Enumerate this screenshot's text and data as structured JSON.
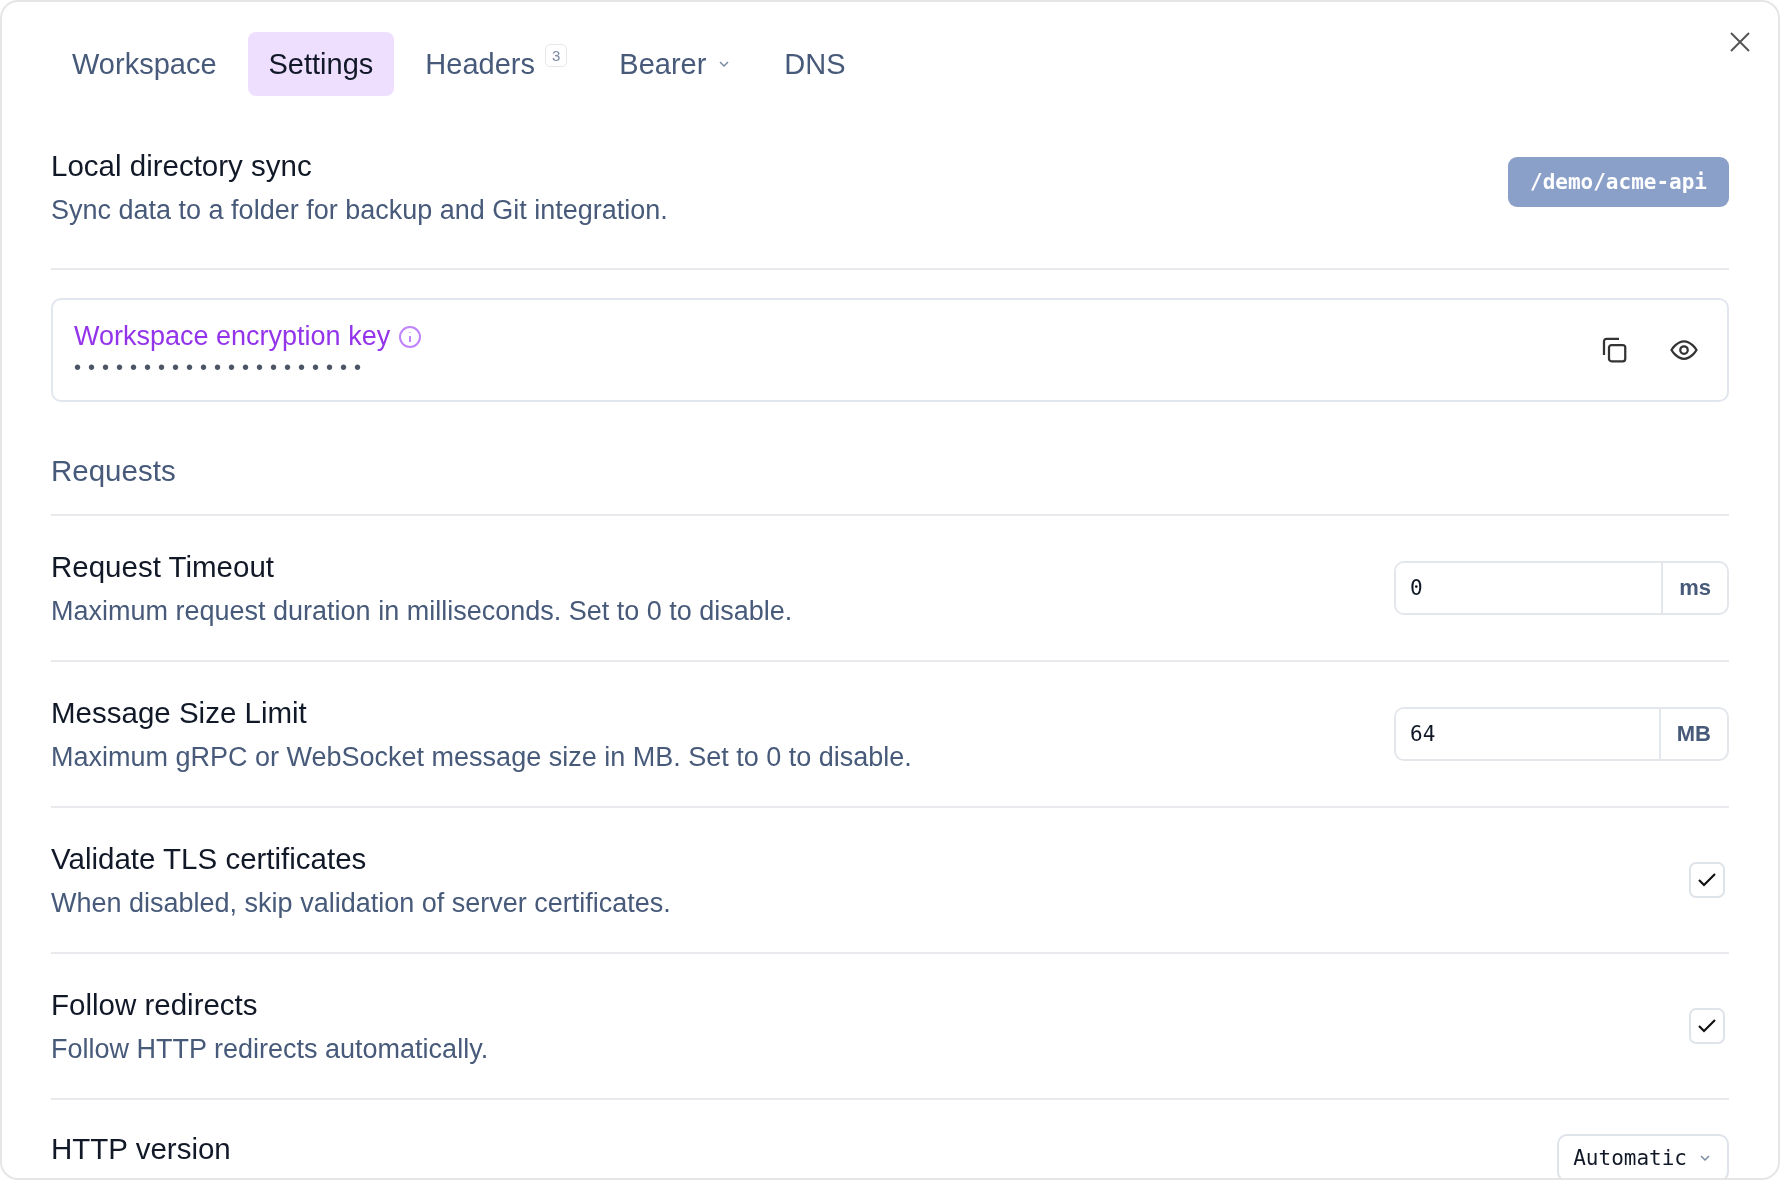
{
  "tabs": [
    {
      "label": "Workspace",
      "selected": false
    },
    {
      "label": "Settings",
      "selected": true
    },
    {
      "label": "Headers",
      "selected": false,
      "badge": "3"
    },
    {
      "label": "Bearer",
      "selected": false,
      "dropdown": true
    },
    {
      "label": "DNS",
      "selected": false
    }
  ],
  "sync": {
    "title": "Local directory sync",
    "description": "Sync data to a folder for backup and Git integration.",
    "path": "/demo/acme-api"
  },
  "encryption_key": {
    "label": "Workspace encryption key",
    "value": "•••••••••••••••••••••"
  },
  "section_title": "Requests",
  "settings": [
    {
      "kind": "number",
      "title": "Request Timeout",
      "description": "Maximum request duration in milliseconds. Set to 0 to disable.",
      "value": "0",
      "unit": "ms"
    },
    {
      "kind": "number",
      "title": "Message Size Limit",
      "description": "Maximum gRPC or WebSocket message size in MB. Set to 0 to disable.",
      "value": "64",
      "unit": "MB"
    },
    {
      "kind": "checkbox",
      "title": "Validate TLS certificates",
      "description": "When disabled, skip validation of server certificates.",
      "checked": true
    },
    {
      "kind": "checkbox",
      "title": "Follow redirects",
      "description": "Follow HTTP redirects automatically.",
      "checked": true
    },
    {
      "kind": "select",
      "title": "HTTP version",
      "value": "Automatic"
    }
  ]
}
